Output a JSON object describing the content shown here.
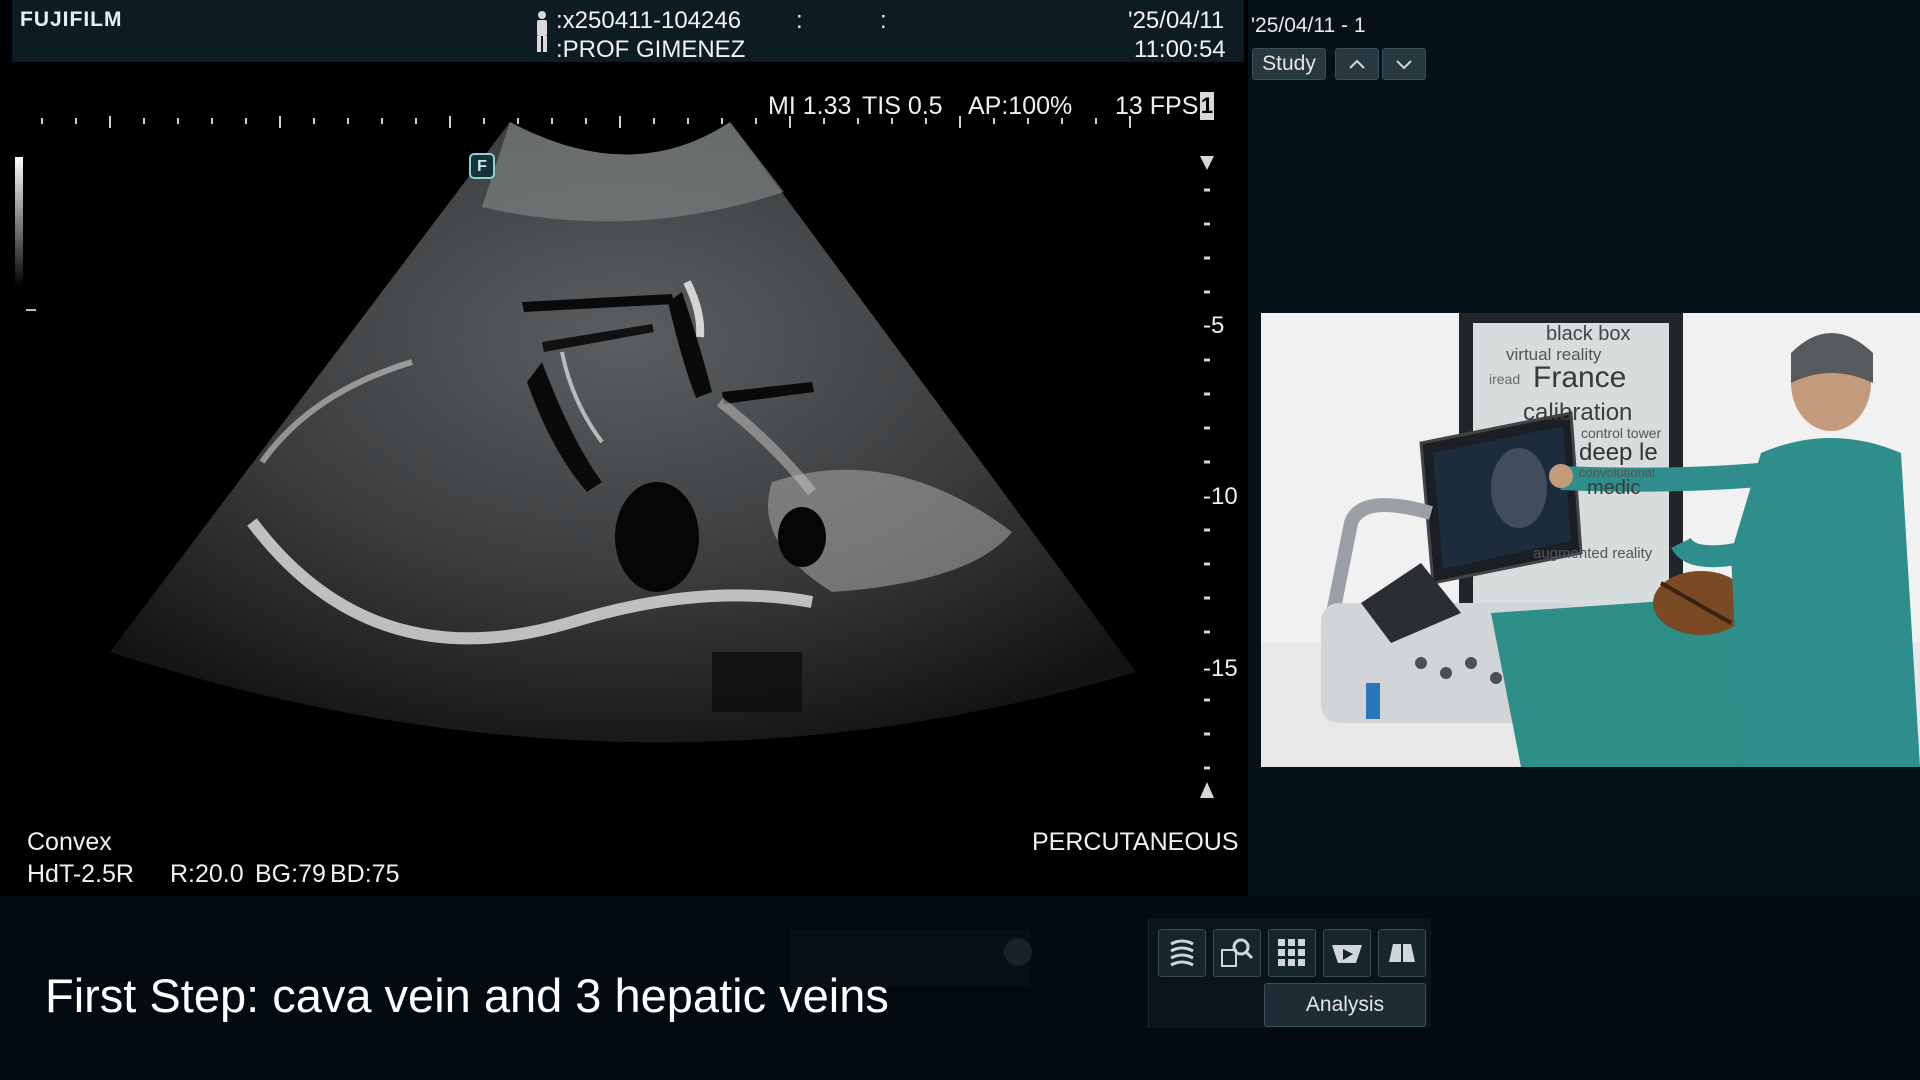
{
  "header": {
    "brand": "FUJIFILM",
    "patient_id": ":x250411-104246",
    "operator": ":PROF GIMENEZ",
    "sep1": ":",
    "sep2": ":",
    "date": "'25/04/11",
    "time": "11:00:54"
  },
  "scan": {
    "mi": "MI 1.33",
    "tis": "TIS 0.5",
    "ap": "AP:100%",
    "fps": "13 FPS",
    "fps_box": "1",
    "focus_marker": "F",
    "depth_labels": [
      "-5",
      "-10",
      "-15"
    ],
    "probe_type": "Convex",
    "probe_params": "HdT-2.5R",
    "r_value": "R:20.0",
    "bg_value": "BG:79",
    "bd_value": "BD:75",
    "preset": "PERCUTANEOUS"
  },
  "right_panel": {
    "exam_label": "'25/04/11 - 1",
    "study_button": "Study",
    "up_icon": "chevron-up-icon",
    "down_icon": "chevron-down-icon",
    "analysis_button": "Analysis"
  },
  "video": {
    "poster_lines": [
      "black box",
      "virtual reality",
      "France",
      "iread",
      "calibration",
      "control tower",
      "deep le",
      "convolutional",
      "medic",
      "augmented reality"
    ]
  },
  "toolbar": {
    "icons": [
      "layers-icon",
      "search-zoom-icon",
      "grid-icon",
      "play-icon",
      "bookmark-icon"
    ]
  },
  "caption": "First Step: cava vein and 3 hepatic veins",
  "colors": {
    "header_bg": "#0d1b22",
    "panel_bg": "#06121a",
    "accent_button": "#28383f",
    "scrub_green": "#2d8f88"
  }
}
